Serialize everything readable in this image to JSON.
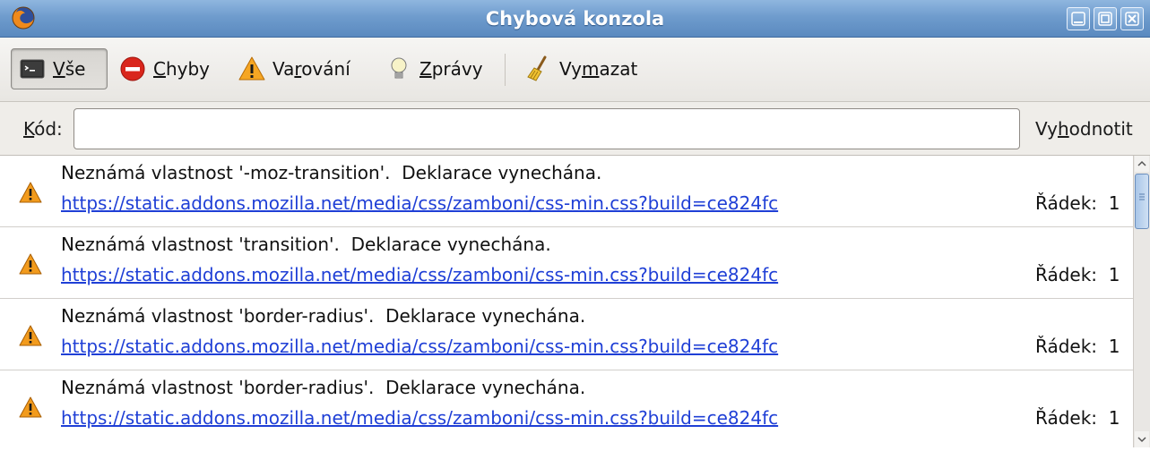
{
  "window": {
    "title": "Chybová konzola",
    "app_icon": "firefox-icon",
    "controls": [
      "minimize-icon",
      "maximize-icon",
      "close-icon"
    ]
  },
  "toolbar": {
    "all": {
      "label_pre": "",
      "label_u": "V",
      "label_post": "še",
      "icon": "console-icon",
      "pressed": true
    },
    "errors": {
      "label_pre": "",
      "label_u": "C",
      "label_post": "hyby",
      "icon": "error-icon"
    },
    "warnings": {
      "label_pre": "Va",
      "label_u": "r",
      "label_post": "ování",
      "icon": "warning-icon"
    },
    "messages": {
      "label_pre": "",
      "label_u": "Z",
      "label_post": "právy",
      "icon": "lightbulb-icon"
    },
    "clear": {
      "label_pre": "Vy",
      "label_u": "m",
      "label_post": "azat",
      "icon": "broom-icon"
    }
  },
  "code": {
    "label_u": "K",
    "label_post": "ód:",
    "value": "",
    "evaluate_pre": "Vy",
    "evaluate_u": "h",
    "evaluate_post": "odnotit"
  },
  "messages": [
    {
      "text": "Neznámá vlastnost '-moz-transition'.  Deklarace vynechána.",
      "url": "https://static.addons.mozilla.net/media/css/zamboni/css-min.css?build=ce824fc",
      "line_label": "Řádek:",
      "line": "1",
      "icon": "warning-icon"
    },
    {
      "text": "Neznámá vlastnost 'transition'.  Deklarace vynechána.",
      "url": "https://static.addons.mozilla.net/media/css/zamboni/css-min.css?build=ce824fc",
      "line_label": "Řádek:",
      "line": "1",
      "icon": "warning-icon"
    },
    {
      "text": "Neznámá vlastnost 'border-radius'.  Deklarace vynechána.",
      "url": "https://static.addons.mozilla.net/media/css/zamboni/css-min.css?build=ce824fc",
      "line_label": "Řádek:",
      "line": "1",
      "icon": "warning-icon"
    },
    {
      "text": "Neznámá vlastnost 'border-radius'.  Deklarace vynechána.",
      "url": "https://static.addons.mozilla.net/media/css/zamboni/css-min.css?build=ce824fc",
      "line_label": "Řádek:",
      "line": "1",
      "icon": "warning-icon"
    }
  ],
  "colors": {
    "titlebar": "#6f9ccd",
    "link": "#1f3fd6",
    "warning": "#f29b1d"
  }
}
